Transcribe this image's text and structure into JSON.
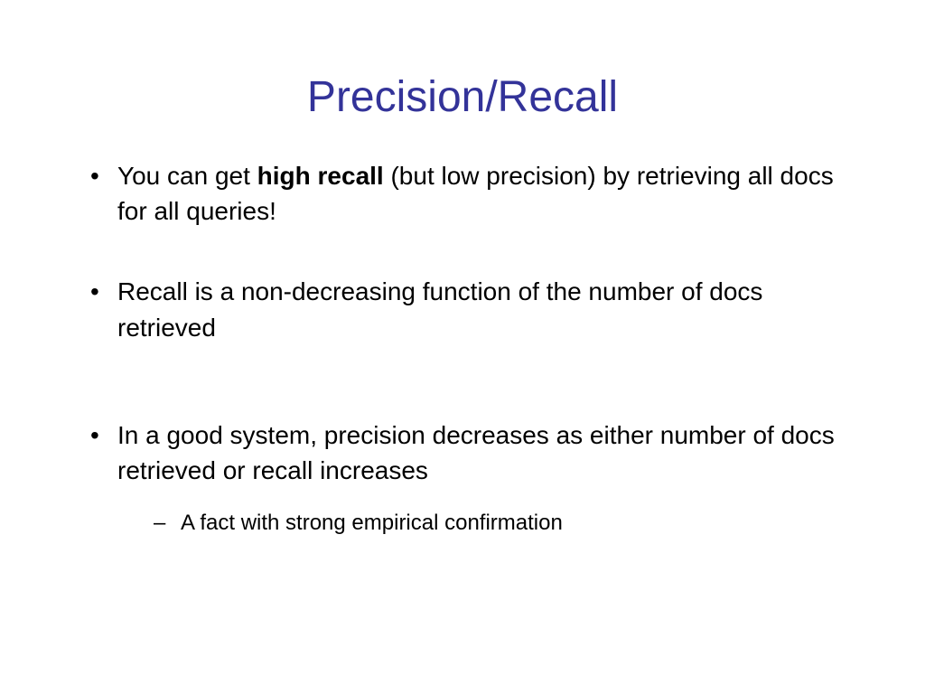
{
  "title": "Precision/Recall",
  "bullets": [
    {
      "prefix": "You can get ",
      "bold": "high recall",
      "suffix": " (but low precision) by retrieving all docs for all queries!"
    },
    {
      "text": "Recall is a non-decreasing function of the number of docs retrieved"
    },
    {
      "text": "In a good system, precision decreases as either number of docs retrieved or recall increases",
      "sub": "A fact with strong empirical confirmation"
    }
  ]
}
